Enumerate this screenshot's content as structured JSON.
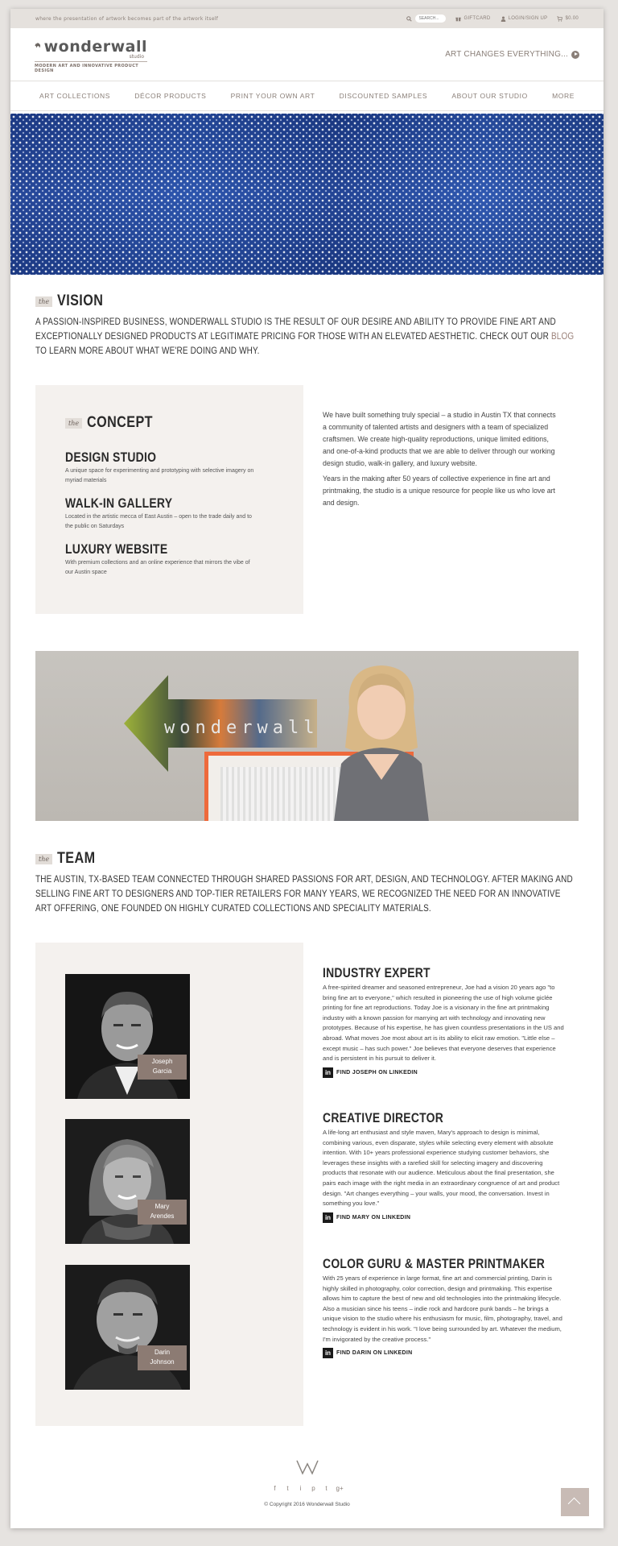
{
  "topbar": {
    "tagline": "where the presentation of artwork becomes part of the artwork itself",
    "search_placeholder": "SEARCH...",
    "giftcard": "GIFTCARD",
    "login": "LOGIN/SIGN UP",
    "cart": "$0.00"
  },
  "header": {
    "logo_word": "wonderwall",
    "logo_studio": "studio",
    "logo_tagline": "MODERN ART AND INNOVATIVE PRODUCT DESIGN",
    "cta": "ART CHANGES EVERYTHING..."
  },
  "nav": {
    "items": [
      "ART COLLECTIONS",
      "DÉCOR PRODUCTS",
      "PRINT YOUR OWN ART",
      "DISCOUNTED SAMPLES",
      "ABOUT OUR STUDIO",
      "MORE"
    ]
  },
  "vision": {
    "the": "the",
    "title": "VISION",
    "text_before": "A PASSION-INSPIRED BUSINESS, WONDERWALL STUDIO IS THE RESULT OF OUR DESIRE AND ABILITY TO PROVIDE FINE ART AND EXCEPTIONALLY DESIGNED PRODUCTS AT LEGITIMATE PRICING FOR THOSE WITH AN ELEVATED AESTHETIC. CHECK OUT OUR ",
    "link": "BLOG",
    "text_after": " TO LEARN MORE ABOUT WHAT WE'RE DOING AND WHY."
  },
  "concept": {
    "the": "the",
    "title": "CONCEPT",
    "items": [
      {
        "title": "DESIGN STUDIO",
        "desc": "A unique space for experimenting and prototyping with selective imagery on myriad materials"
      },
      {
        "title": "WALK-IN GALLERY",
        "desc": "Located in the artistic mecca of East Austin – open to the trade daily and to the public on Saturdays"
      },
      {
        "title": "LUXURY WEBSITE",
        "desc": "With premium collections and an online experience that mirrors the vibe of our Austin space"
      }
    ],
    "paragraph1": "We have built something truly special – a studio in Austin TX that connects a community of talented artists and designers with a team of specialized craftsmen. We create high-quality reproductions, unique limited editions, and one-of-a-kind products that we are able to deliver through our working design studio, walk-in gallery, and luxury website.",
    "paragraph2": "Years in the making after 50 years of collective experience in fine art and printmaking, the studio is a unique resource for people like us who love art and design."
  },
  "photo": {
    "arrow_word": "wonderwall"
  },
  "team": {
    "the": "the",
    "title": "TEAM",
    "text": "THE AUSTIN, TX-BASED TEAM CONNECTED THROUGH SHARED PASSIONS FOR ART, DESIGN, AND TECHNOLOGY. AFTER MAKING AND SELLING FINE ART TO DESIGNERS AND TOP-TIER RETAILERS FOR MANY YEARS, WE RECOGNIZED THE NEED FOR AN INNOVATIVE ART OFFERING, ONE FOUNDED ON HIGHLY CURATED COLLECTIONS AND SPECIALITY MATERIALS.",
    "members": [
      {
        "first": "Joseph",
        "last": "Garcia",
        "role": "INDUSTRY EXPERT",
        "bio": "A free-spirited dreamer and seasoned entrepreneur, Joe had a vision 20 years ago \"to bring fine art to everyone,\" which resulted in pioneering the use of high volume giclée printing for fine art reproductions. Today Joe is a visionary in the fine art printmaking industry with a known passion for marrying art with technology and innovating new prototypes. Because of his expertise, he has given countless presentations in the US and abroad. What moves Joe most about art is its ability to elicit raw emotion. \"Little else – except music – has such power.\" Joe believes that everyone deserves that experience and is persistent in his pursuit to deliver it.",
        "linkedin": "FIND JOSEPH ON LINKEDIN"
      },
      {
        "first": "Mary",
        "last": "Arendes",
        "role": "CREATIVE DIRECTOR",
        "bio": "A life-long art enthusiast and style maven, Mary's approach to design is minimal, combining various, even disparate, styles while selecting every element with absolute intention. With 10+ years professional experience studying customer behaviors, she leverages these insights with a rarefied skill for selecting imagery and discovering products that resonate with our audience. Meticulous about the final presentation, she pairs each image with the right media in an extraordinary congruence of art and product design. \"Art changes everything – your walls, your mood, the conversation. Invest in something you love.\"",
        "linkedin": "FIND MARY ON LINKEDIN"
      },
      {
        "first": "Darin",
        "last": "Johnson",
        "role": "COLOR GURU & MASTER PRINTMAKER",
        "bio": "With 25 years of experience in large format, fine art and commercial printing, Darin is highly skilled in photography, color correction, design and printmaking. This expertise allows him to capture the best of new and old technologies into the printmaking lifecycle. Also a musician since his teens – indie rock and hardcore punk bands – he brings a unique vision to the studio where his enthusiasm for music, film, photography, travel, and technology is evident in his work. \"I love being surrounded by art. Whatever the medium, I'm invigorated by the creative process.\"",
        "linkedin": "FIND DARIN ON LINKEDIN"
      }
    ]
  },
  "footer": {
    "logo": "W",
    "socials": [
      "f",
      "t",
      "i",
      "p",
      "t",
      "g+"
    ],
    "copyright": "© Copyright 2016 Wonderwall Studio"
  }
}
